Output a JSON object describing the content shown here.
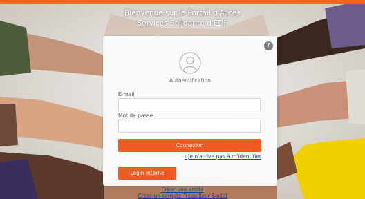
{
  "colors": {
    "accent": "#f15a24",
    "link": "#1a4fa8"
  },
  "header": {
    "welcome_line1": "Bienvenue sur le Portail d'Accès",
    "welcome_line2": "Services Solidarité d'EDF"
  },
  "login": {
    "help_label": "?",
    "avatar_icon": "user-circle-icon",
    "title": "Authentification",
    "email_label": "E-mail",
    "email_value": "",
    "password_label": "Mot de passe",
    "password_value": "",
    "submit_label": "Connexion",
    "forgot_link": "› Je n'arrive pas à m'identifier",
    "internal_login_label": "Login interne"
  },
  "footer_links": {
    "create_entity": "Créer une entité",
    "create_social_worker": "Créer un compte Travailleur Social"
  }
}
